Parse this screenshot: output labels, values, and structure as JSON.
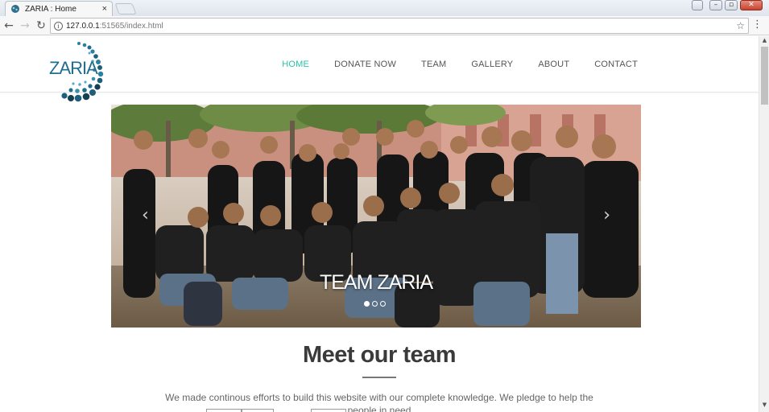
{
  "browser": {
    "tab_title": "ZARIA : Home",
    "tab_close": "×",
    "url_host": "127.0.0.1",
    "url_path": ":51565/index.html"
  },
  "site": {
    "logo_text": "ZARIA",
    "nav": [
      {
        "label": "HOME",
        "active": true
      },
      {
        "label": "DONATE NOW"
      },
      {
        "label": "TEAM"
      },
      {
        "label": "GALLERY"
      },
      {
        "label": "ABOUT"
      },
      {
        "label": "CONTACT"
      }
    ],
    "accent_color": "#27c2a8"
  },
  "carousel": {
    "caption": "TEAM ZARIA",
    "prev": "‹",
    "next": "›",
    "slide_count": 3,
    "active_slide": 1
  },
  "team_section": {
    "title": "Meet our team",
    "text": "We made continous efforts to build this website with our complete knowledge. We pledge to help the people in need"
  }
}
